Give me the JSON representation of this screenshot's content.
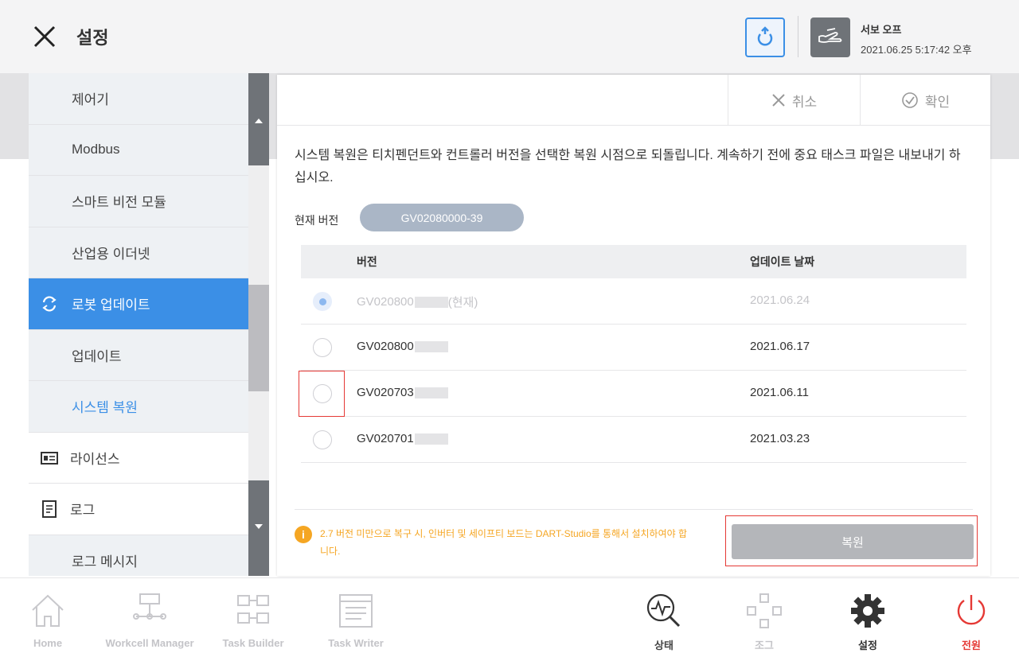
{
  "header": {
    "title": "설정",
    "servo_label": "서보 오프",
    "timestamp": "2021.06.25 5:17:42 오후"
  },
  "sidebar": {
    "items": [
      {
        "label": "제어기"
      },
      {
        "label": "Modbus"
      },
      {
        "label": "스마트 비전 모듈"
      },
      {
        "label": "산업용 이더넷"
      },
      {
        "label": "로봇 업데이트"
      },
      {
        "label": "업데이트"
      },
      {
        "label": "시스템 복원"
      },
      {
        "label": "라이선스"
      },
      {
        "label": "로그"
      },
      {
        "label": "로그 메시지"
      }
    ]
  },
  "panel": {
    "cancel_label": "취소",
    "confirm_label": "확인",
    "description": "시스템 복원은 티치펜던트와 컨트롤러 버전을 선택한 복원 시점으로 되돌립니다. 계속하기 전에 중요 태스크 파일은 내보내기 하십시오.",
    "current_version_label": "현재 버전",
    "current_version": "GV02080000-39",
    "table": {
      "headers": {
        "version": "버전",
        "date": "업데이트 날짜"
      },
      "rows": [
        {
          "version": "GV020800",
          "suffix": "(현재)",
          "date": "2021.06.24",
          "state": "current"
        },
        {
          "version": "GV020800",
          "suffix": "",
          "date": "2021.06.17",
          "state": "unchecked"
        },
        {
          "version": "GV020703",
          "suffix": "",
          "date": "2021.06.11",
          "state": "unchecked"
        },
        {
          "version": "GV020701",
          "suffix": "",
          "date": "2021.03.23",
          "state": "unchecked"
        }
      ]
    },
    "warning": "2.7 버전 미만으로 복구 시, 인버터 및 세이프티 보드는 DART-Studio를 통해서 설치하여야 합니다.",
    "restore_label": "복원"
  },
  "footer": {
    "items": [
      {
        "label": "Home"
      },
      {
        "label": "Workcell Manager"
      },
      {
        "label": "Task Builder"
      },
      {
        "label": "Task Writer"
      },
      {
        "label": "상태"
      },
      {
        "label": "조그"
      },
      {
        "label": "설정"
      },
      {
        "label": "전원"
      }
    ]
  },
  "colors": {
    "accent": "#3b8fe6",
    "warning": "#f5a623",
    "power": "#e53935",
    "highlight": "#e53935"
  }
}
